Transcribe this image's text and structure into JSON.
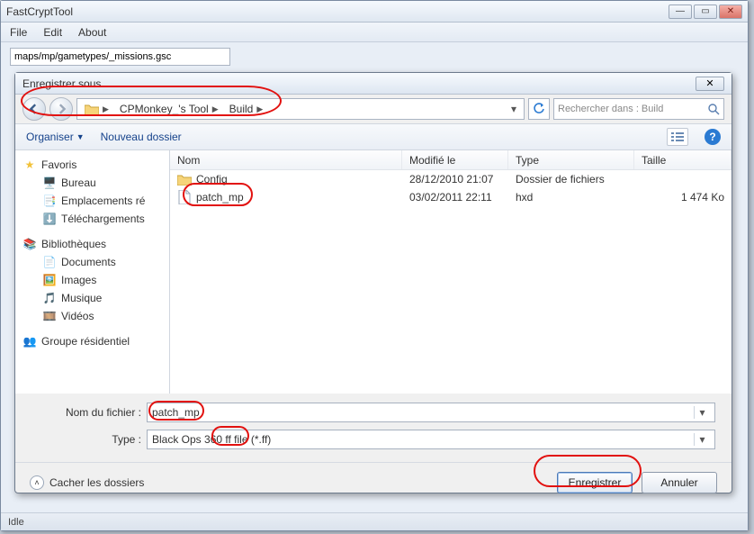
{
  "outer": {
    "title": "FastCryptTool",
    "menu": {
      "file": "File",
      "edit": "Edit",
      "about": "About"
    },
    "path_value": "maps/mp/gametypes/_missions.gsc",
    "status": "Idle"
  },
  "dialog": {
    "title": "Enregistrer sous",
    "breadcrumb": {
      "seg1": "CPMonkey_'s Tool",
      "seg2": "Build"
    },
    "search_placeholder": "Rechercher dans : Build",
    "toolbar": {
      "organize": "Organiser",
      "new_folder": "Nouveau dossier"
    },
    "columns": {
      "name": "Nom",
      "modified": "Modifié le",
      "type": "Type",
      "size": "Taille"
    },
    "sidebar": {
      "favorites": {
        "head": "Favoris",
        "items": [
          "Bureau",
          "Emplacements ré",
          "Téléchargements"
        ]
      },
      "libraries": {
        "head": "Bibliothèques",
        "items": [
          "Documents",
          "Images",
          "Musique",
          "Vidéos"
        ]
      },
      "homegroup": {
        "head": "Groupe résidentiel"
      }
    },
    "rows": [
      {
        "name": "Config",
        "modified": "28/12/2010 21:07",
        "type": "Dossier de fichiers",
        "size": ""
      },
      {
        "name": "patch_mp",
        "modified": "03/02/2011 22:11",
        "type": "hxd",
        "size": "1 474 Ko"
      }
    ],
    "fields": {
      "name_label": "Nom du fichier :",
      "name_value": "patch_mp",
      "type_label": "Type :",
      "type_value": "Black Ops 360 ff file (*.ff)"
    },
    "footer": {
      "hide": "Cacher les dossiers",
      "save": "Enregistrer",
      "cancel": "Annuler"
    }
  }
}
